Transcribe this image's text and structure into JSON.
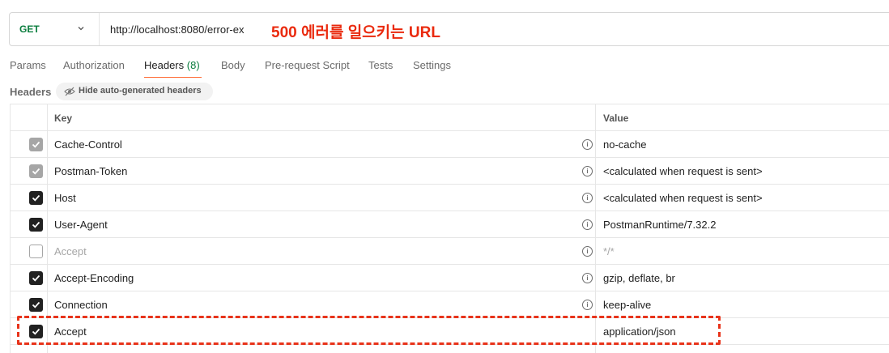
{
  "request": {
    "method": "GET",
    "url": "http://localhost:8080/error-ex",
    "annotation": "500 에러를 일으키는 URL"
  },
  "tabs": [
    {
      "label": "Params"
    },
    {
      "label": "Authorization"
    },
    {
      "label": "Headers",
      "count": "(8)",
      "active": true
    },
    {
      "label": "Body"
    },
    {
      "label": "Pre-request Script"
    },
    {
      "label": "Tests"
    },
    {
      "label": "Settings"
    }
  ],
  "headers_section": {
    "label": "Headers",
    "hide_button": "Hide auto-generated headers"
  },
  "table": {
    "columns": {
      "key": "Key",
      "value": "Value"
    },
    "rows": [
      {
        "key": "Cache-Control",
        "value": "no-cache",
        "state": "auto"
      },
      {
        "key": "Postman-Token",
        "value": "<calculated when request is sent>",
        "state": "auto"
      },
      {
        "key": "Host",
        "value": "<calculated when request is sent>",
        "state": "checked"
      },
      {
        "key": "User-Agent",
        "value": "PostmanRuntime/7.32.2",
        "state": "checked"
      },
      {
        "key": "Accept",
        "value": "*/*",
        "state": "unchecked"
      },
      {
        "key": "Accept-Encoding",
        "value": "gzip, deflate, br",
        "state": "checked"
      },
      {
        "key": "Connection",
        "value": "keep-alive",
        "state": "checked"
      },
      {
        "key": "Accept",
        "value": "application/json",
        "state": "checked"
      }
    ],
    "info_icon": "i"
  },
  "colors": {
    "accent": "#ff6c37",
    "method_green": "#0b7d3e",
    "annotation_red": "#ea2a0e"
  }
}
